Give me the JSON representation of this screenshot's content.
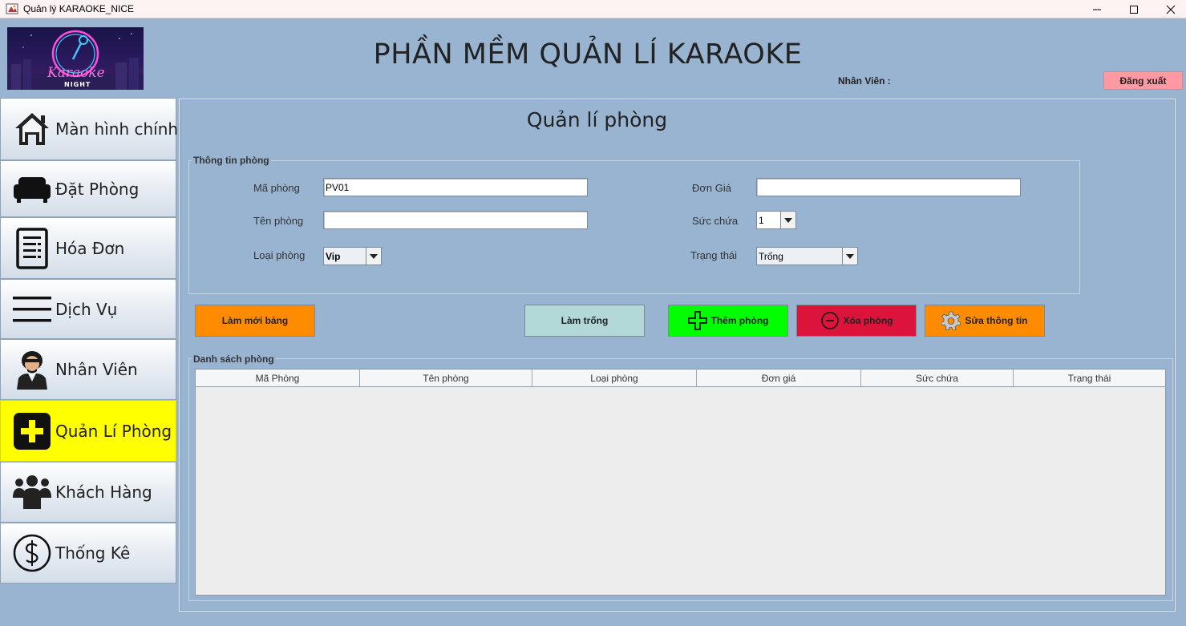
{
  "window": {
    "title": "Quản lý KARAOKE_NICE"
  },
  "header": {
    "title": "PHẦN MỀM QUẢN LÍ KARAOKE",
    "employee_label": "Nhân Viên :",
    "logout_label": "Đăng xuất",
    "logo_text": "Karaoke",
    "logo_subtext": "NIGHT"
  },
  "sidebar": {
    "items": [
      {
        "label": "Màn hình chính",
        "icon": "home-icon"
      },
      {
        "label": "Đặt Phòng",
        "icon": "sofa-icon"
      },
      {
        "label": "Hóa Đơn",
        "icon": "invoice-icon"
      },
      {
        "label": "Dịch Vụ",
        "icon": "menu-icon"
      },
      {
        "label": "Nhân Viên",
        "icon": "employee-icon"
      },
      {
        "label": "Quản Lí Phòng",
        "icon": "plus-icon",
        "active": true
      },
      {
        "label": "Khách Hàng",
        "icon": "customers-icon"
      },
      {
        "label": "Thống Kê",
        "icon": "dollar-icon"
      }
    ]
  },
  "panel": {
    "title": "Quản lí phòng",
    "info_group_title": "Thông tin phòng",
    "fields": {
      "room_id_label": "Mã phòng",
      "room_id_value": "PV01",
      "room_name_label": "Tên phòng",
      "room_name_value": "",
      "room_type_label": "Loại phòng",
      "room_type_value": "Vip",
      "price_label": "Đơn Giá",
      "price_value": "",
      "capacity_label": "Sức chứa",
      "capacity_value": "1",
      "status_label": "Trạng thái",
      "status_value": "Trống"
    },
    "buttons": {
      "refresh_table": "Làm mới bảng",
      "clear": "Làm trống",
      "add_room": "Thêm phòng",
      "delete_room": "Xóa phòng",
      "edit_info": "Sửa thông tin"
    },
    "list_group_title": "Danh sách phòng",
    "table": {
      "columns": [
        "Mã Phòng",
        "Tên phòng",
        "Loại phòng",
        "Đơn giá",
        "Sức chứa",
        "Trạng thái"
      ],
      "rows": []
    }
  },
  "colors": {
    "background": "#99b4d1",
    "active_sidebar": "#ffff00",
    "refresh_button": "#ff8c00",
    "clear_button": "#b2d8d8",
    "add_button": "#00ff00",
    "delete_button": "#dc143c",
    "edit_button": "#ff8c00",
    "logout_button": "#ff9aa2"
  }
}
